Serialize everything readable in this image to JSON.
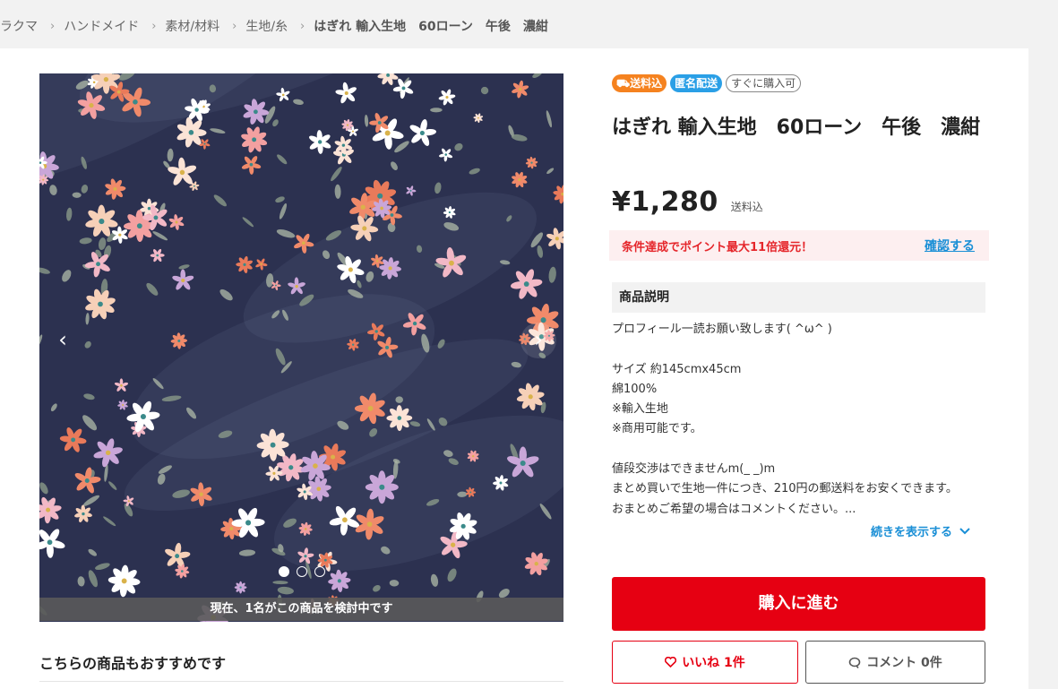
{
  "breadcrumb": [
    "ラクマ",
    "ハンドメイド",
    "素材/材料",
    "生地/糸",
    "はぎれ 輸入生地　60ローン　午後　濃紺"
  ],
  "breadcrumb_separator": "›",
  "gallery": {
    "prev_icon": "chevron-left-icon",
    "next_icon": "chevron-right-icon",
    "dot_count": 3,
    "active_dot": 1,
    "viewers_text": "現在、1名がこの商品を検討中です"
  },
  "recommend_title": "こちらの商品もおすすめです",
  "badges": {
    "free_shipping": "送料込",
    "anonymous": "匿名配送",
    "buy_now": "すぐに購入可"
  },
  "product": {
    "title": "はぎれ 輸入生地　60ローン　午後　濃紺",
    "price": "¥1,280",
    "shipping_note": "送料込"
  },
  "points": {
    "message": "条件達成でポイント最大11倍還元！",
    "link": "確認する"
  },
  "description": {
    "heading": "商品説明",
    "lines": [
      "プロフィール一読お願い致します( ^ω^ )",
      "",
      "サイズ 約145cmx45cm",
      "綿100%",
      "※輸入生地",
      "※商用可能です。",
      "",
      "値段交渉はできませんm(_ _)m",
      "まとめ買いで生地一件につき、210円の郵送料をお安くできます。",
      "おまとめご希望の場合はコメントください。..."
    ],
    "more_label": "続きを表示する"
  },
  "actions": {
    "buy_label": "購入に進む",
    "like_label": "いいね 1件",
    "comment_label": "コメント 0件"
  },
  "colors": {
    "accent_red": "#e60012",
    "link_blue": "#1a8fd6",
    "badge_orange": "#f5821f",
    "badge_blue": "#2a9fe6",
    "fabric_navy": "#2c3150"
  }
}
